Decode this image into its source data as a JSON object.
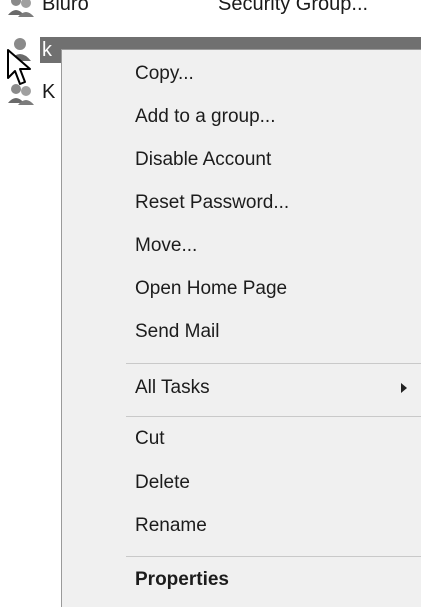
{
  "list": {
    "rows": [
      {
        "name": "Biuro",
        "type": "Security Group...",
        "icon": "group-icon"
      },
      {
        "name": "k",
        "type": "",
        "icon": "user-icon",
        "selected": true
      },
      {
        "name": "K",
        "type": "",
        "icon": "group-icon"
      }
    ]
  },
  "context_menu": {
    "items": [
      {
        "label": "Copy..."
      },
      {
        "label": "Add to a group..."
      },
      {
        "label": "Disable Account"
      },
      {
        "label": "Reset Password..."
      },
      {
        "label": "Move..."
      },
      {
        "label": "Open Home Page"
      },
      {
        "label": "Send Mail"
      },
      {
        "label": "All Tasks",
        "submenu": true,
        "icon": "chevron-right-icon"
      },
      {
        "label": "Cut"
      },
      {
        "label": "Delete"
      },
      {
        "label": "Rename"
      },
      {
        "label": "Properties",
        "bold": true
      }
    ]
  },
  "colors": {
    "menu_background": "#f0f0f0",
    "selection": "#707070",
    "separator": "#c9c9c9"
  }
}
